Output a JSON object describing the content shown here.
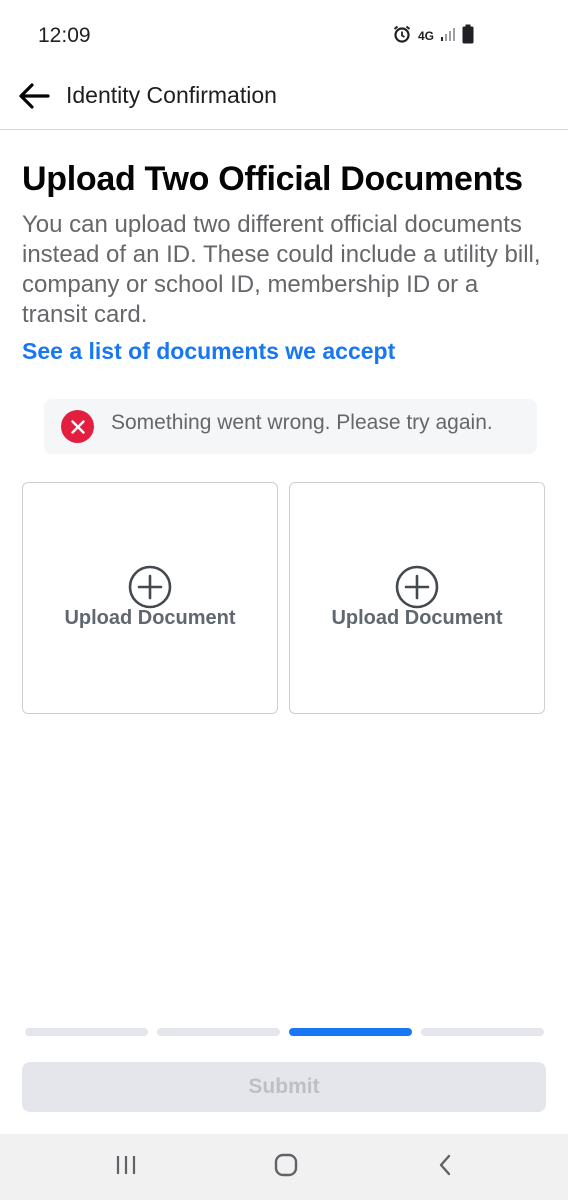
{
  "status_bar": {
    "time": "12:09",
    "network": "4G",
    "icons": [
      "alarm-icon",
      "network-4g-icon",
      "signal-icon",
      "battery-icon"
    ]
  },
  "header": {
    "title": "Identity Confirmation",
    "back_icon": "arrow-left-icon"
  },
  "main": {
    "title": "Upload Two Official Documents",
    "description": "You can upload two different official documents instead of an ID. These could include a utility bill, company or school ID, membership ID or a transit card.",
    "link": "See a list of documents we accept",
    "error": {
      "icon": "error-x-icon",
      "message": "Something went wrong. Please try again."
    },
    "uploads": [
      {
        "label": "Upload Document",
        "icon": "plus-circle-icon"
      },
      {
        "label": "Upload Document",
        "icon": "plus-circle-icon"
      }
    ]
  },
  "progress": {
    "total_steps": 4,
    "current_step": 3
  },
  "footer": {
    "submit_label": "Submit"
  },
  "system_nav": {
    "icons": [
      "recent-apps-icon",
      "home-icon",
      "back-chevron-icon"
    ]
  },
  "colors": {
    "accent": "#1877f2",
    "error": "#e41e3f",
    "disabled_bg": "#e4e6eb",
    "disabled_text": "#bcc0c4",
    "secondary_text": "#65676b"
  }
}
